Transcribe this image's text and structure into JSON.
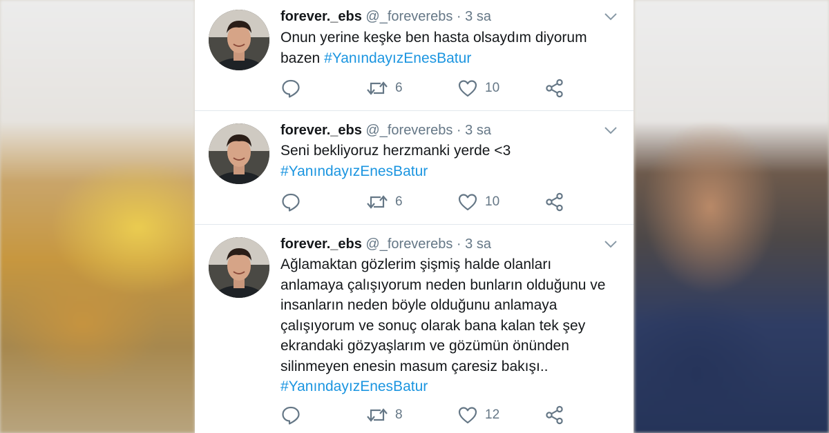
{
  "tweets": [
    {
      "name": "forever._ebs",
      "handle": "@_foreverebs",
      "separator": "·",
      "time": "3 sa",
      "text": "Onun yerine keşke ben hasta olsaydım diyorum bazen",
      "hashtag": "#YanındayızEnesBatur",
      "retweets": "6",
      "likes": "10"
    },
    {
      "name": "forever._ebs",
      "handle": "@_foreverebs",
      "separator": "·",
      "time": "3 sa",
      "text": "Seni bekliyoruz herzmanki yerde <3",
      "hashtag": "#YanındayızEnesBatur",
      "retweets": "6",
      "likes": "10"
    },
    {
      "name": "forever._ebs",
      "handle": "@_foreverebs",
      "separator": "·",
      "time": "3 sa",
      "text": "Ağlamaktan gözlerim şişmiş halde olanları anlamaya çalışıyorum neden bunların olduğunu ve insanların neden böyle olduğunu anlamaya çalışıyorum ve sonuç olarak bana kalan tek şey ekrandaki gözyaşlarım ve gözümün önünden silinmeyen enesin masum çaresiz bakışı..",
      "hashtag": "#YanındayızEnesBatur",
      "retweets": "8",
      "likes": "12"
    }
  ],
  "icons": {
    "reply": "reply-icon",
    "retweet": "retweet-icon",
    "like": "heart-icon",
    "share": "share-icon",
    "menu": "chevron-down-icon"
  },
  "colors": {
    "text": "#14171a",
    "secondary": "#657786",
    "link": "#1b95e0",
    "divider": "#e1e8ed"
  }
}
